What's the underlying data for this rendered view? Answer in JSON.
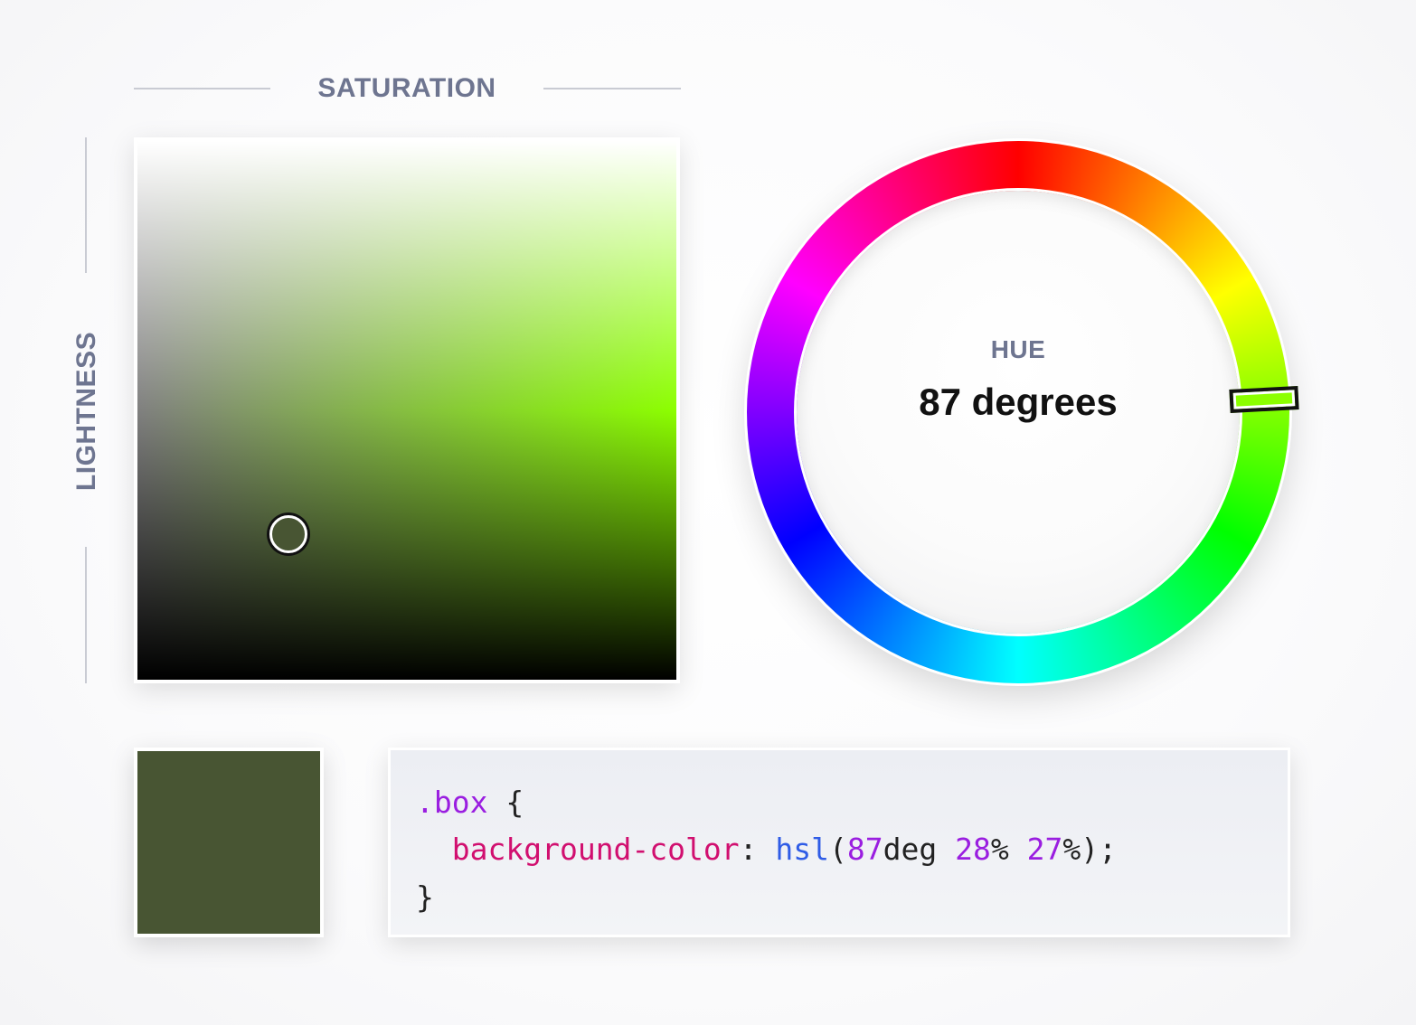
{
  "labels": {
    "saturation": "SATURATION",
    "lightness": "LIGHTNESS"
  },
  "hue": {
    "title": "HUE",
    "value_text": "87 degrees",
    "degrees": 87
  },
  "picker": {
    "saturation_percent": 28,
    "lightness_percent": 27
  },
  "swatch": {
    "color": "#485533"
  },
  "code": {
    "selector": ".box",
    "open_brace": " {",
    "indent": "  ",
    "property": "background-color",
    "colon": ": ",
    "function": "hsl",
    "paren_open": "(",
    "hue_num": "87",
    "hue_unit": "deg ",
    "sat_num": "28",
    "sat_unit": "% ",
    "light_num": "27",
    "light_unit": "%",
    "paren_close": ");",
    "close_brace": "}"
  },
  "colors": {
    "label": "#6e7590",
    "selector": "#9a1ee0",
    "property": "#d10f6f",
    "function": "#2f5ce6",
    "number": "#9a1ee0"
  }
}
